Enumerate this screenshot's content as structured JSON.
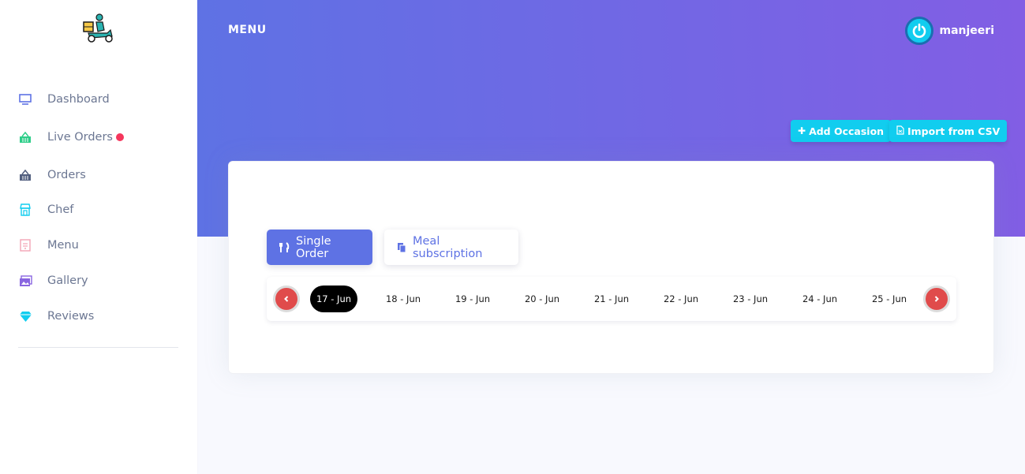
{
  "sidebar": {
    "items": [
      {
        "label": "Dashboard",
        "icon": "monitor-icon",
        "color": "#5e72e4"
      },
      {
        "label": "Live Orders",
        "icon": "basket-icon",
        "color": "#2dce89",
        "live": true
      },
      {
        "label": "Orders",
        "icon": "basket-icon",
        "color": "#525f7f"
      },
      {
        "label": "Chef",
        "icon": "shop-icon",
        "color": "#11cdef"
      },
      {
        "label": "Menu",
        "icon": "menu-card-icon",
        "color": "#f3a4b5"
      },
      {
        "label": "Gallery",
        "icon": "images-icon",
        "color": "#8965e0"
      },
      {
        "label": "Reviews",
        "icon": "diamond-icon",
        "color": "#11cdef"
      }
    ]
  },
  "header": {
    "title": "MENU",
    "user": {
      "name": "manjeeri"
    },
    "buttons": {
      "add_occasion": "Add Occasion",
      "import_csv": "Import from CSV"
    }
  },
  "tabs": {
    "single_order": "Single Order",
    "meal_subscription": "Meal subscription"
  },
  "dates": {
    "items": [
      "17 - Jun",
      "18 - Jun",
      "19 - Jun",
      "20 - Jun",
      "21 - Jun",
      "22 - Jun",
      "23 - Jun",
      "24 - Jun",
      "25 - Jun"
    ],
    "selected": "17 - Jun"
  },
  "colors": {
    "primary": "#5e72e4",
    "gradient_end": "#825ee4",
    "info": "#11cdef",
    "danger": "#e04b4b",
    "live_dot": "#f5365c"
  }
}
